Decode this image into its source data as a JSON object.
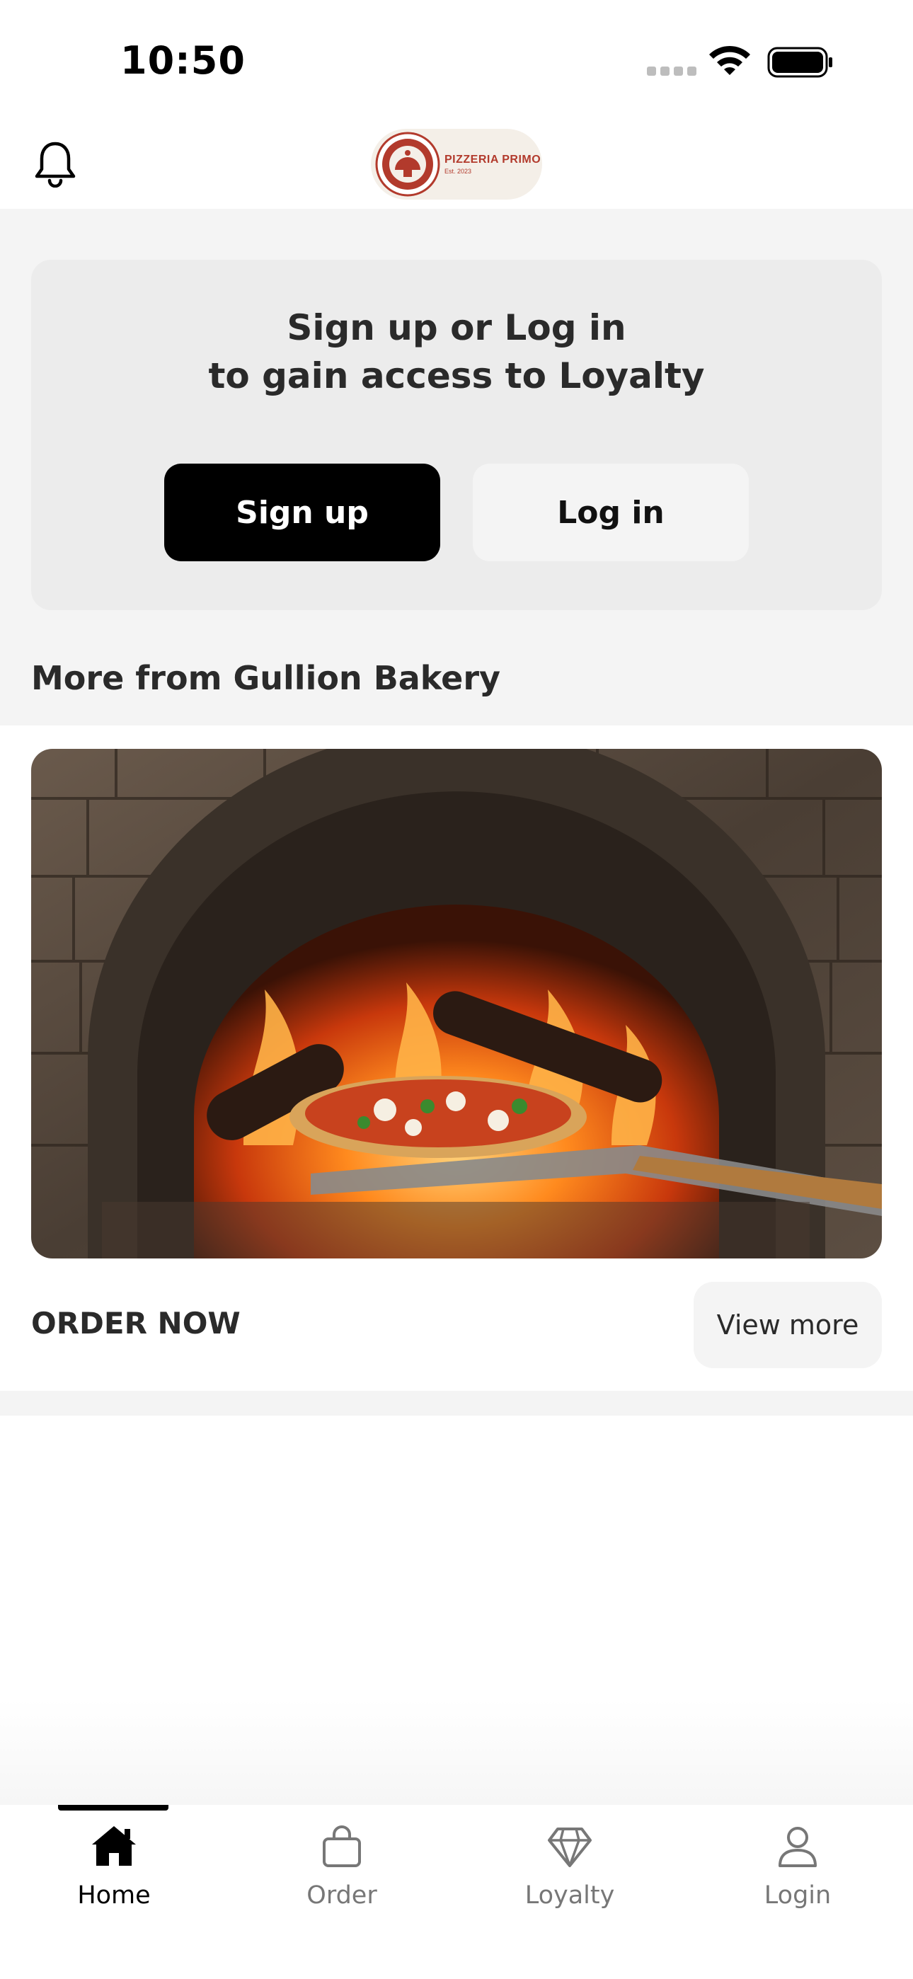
{
  "status_bar": {
    "time": "10:50"
  },
  "header": {
    "brand_name": "PIZZERIA PRIMO",
    "brand_est": "Est. 2023"
  },
  "loyalty": {
    "title_line1": "Sign up or Log in",
    "title_line2": "to gain access to Loyalty",
    "signup_label": "Sign up",
    "login_label": "Log in"
  },
  "more_section": {
    "title": "More from Gullion Bakery"
  },
  "promo": {
    "cta_label": "ORDER NOW",
    "view_more_label": "View more"
  },
  "tabs": [
    {
      "label": "Home",
      "icon": "home-icon",
      "active": true
    },
    {
      "label": "Order",
      "icon": "bag-icon",
      "active": false
    },
    {
      "label": "Loyalty",
      "icon": "diamond-icon",
      "active": false
    },
    {
      "label": "Login",
      "icon": "person-icon",
      "active": false
    }
  ],
  "colors": {
    "primary_button": "#000000",
    "secondary_button": "#f4f4f4",
    "brand_red": "#b23a2c",
    "page_grey": "#f4f4f4",
    "card_grey": "#ececec"
  }
}
